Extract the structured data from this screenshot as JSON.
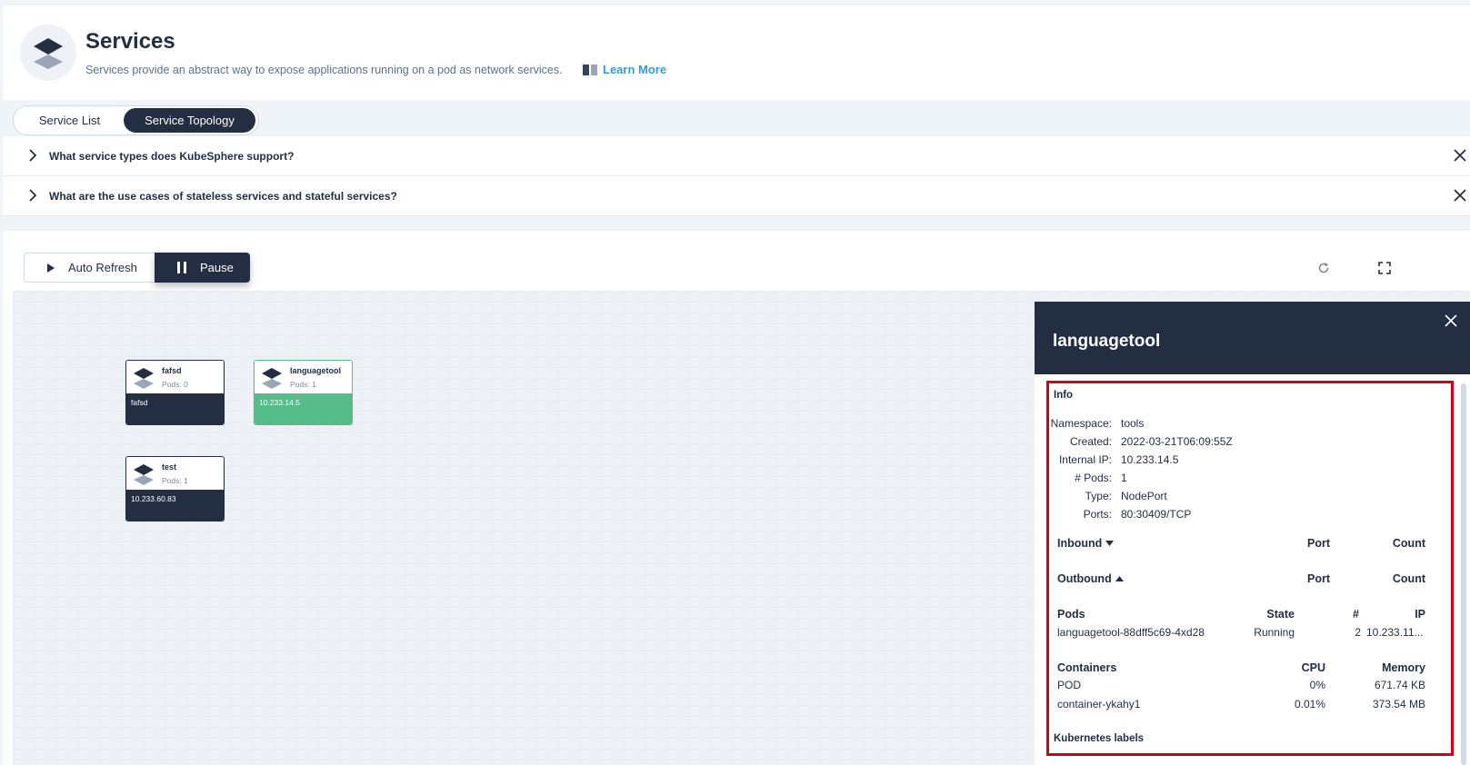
{
  "header": {
    "title": "Services",
    "description": "Services provide an abstract way to expose applications running on a pod as network services.",
    "learn_more": "Learn More"
  },
  "tabs": [
    {
      "label": "Service List",
      "active": false
    },
    {
      "label": "Service Topology",
      "active": true
    }
  ],
  "faq": [
    {
      "question": "What service types does KubeSphere support?"
    },
    {
      "question": "What are the use cases of stateless services and stateful services?"
    }
  ],
  "toolbar": {
    "auto_refresh": "Auto Refresh",
    "pause": "Pause"
  },
  "nodes": [
    {
      "name": "fafsd",
      "pods": "Pods: 0",
      "footer": "fafsd",
      "status_color": "#242e42"
    },
    {
      "name": "languagetool",
      "pods": "Pods: 1",
      "footer": "10.233.14.5",
      "status_color": "#55bc8a"
    },
    {
      "name": "test",
      "pods": "Pods: 1",
      "footer": "10.233.60.83",
      "status_color": "#242e42"
    }
  ],
  "panel": {
    "title": "languagetool",
    "info_label": "Info",
    "info": [
      {
        "key": "Namespace:",
        "value": "tools"
      },
      {
        "key": "Created:",
        "value": "2022-03-21T06:09:55Z"
      },
      {
        "key": "Internal IP:",
        "value": "10.233.14.5"
      },
      {
        "key": "# Pods:",
        "value": "1"
      },
      {
        "key": "Type:",
        "value": "NodePort"
      },
      {
        "key": "Ports:",
        "value": "80:30409/TCP"
      }
    ],
    "inbound": {
      "label": "Inbound",
      "port": "Port",
      "count": "Count"
    },
    "outbound": {
      "label": "Outbound",
      "port": "Port",
      "count": "Count"
    },
    "pods_table": {
      "headers": {
        "name": "Pods",
        "state": "State",
        "num": "#",
        "ip": "IP"
      },
      "rows": [
        {
          "name": "languagetool-88dff5c69-4xd28",
          "state": "Running",
          "num": "2",
          "ip": "10.233.11..."
        }
      ]
    },
    "containers_table": {
      "headers": {
        "name": "Containers",
        "cpu": "CPU",
        "memory": "Memory"
      },
      "rows": [
        {
          "name": "POD",
          "cpu": "0%",
          "memory": "671.74 KB"
        },
        {
          "name": "container-ykahy1",
          "cpu": "0.01%",
          "memory": "373.54 MB"
        }
      ]
    },
    "labels_label": "Kubernetes labels"
  },
  "colors": {
    "dark": "#242e42",
    "green": "#55bc8a",
    "link": "#329dce",
    "highlight": "#d0021b"
  }
}
